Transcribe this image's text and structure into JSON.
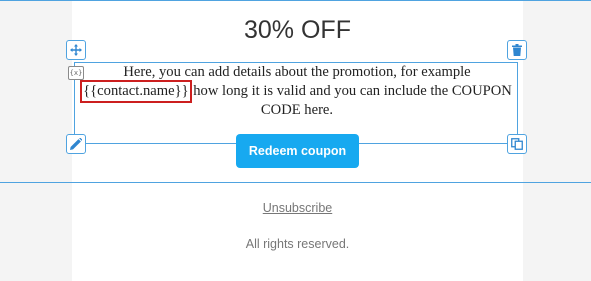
{
  "headline": "30% OFF",
  "body": {
    "before_tag": "Here, you can add details about the promotion, for example",
    "merge_tag": "{{contact.name}}",
    "after_tag": "how long it is valid and you can include the COUPON CODE here."
  },
  "variable_icon_label": "{x}",
  "cta": {
    "label": "Redeem coupon"
  },
  "footer": {
    "unsubscribe": "Unsubscribe",
    "rights": "All rights reserved."
  },
  "toolbar": {
    "move_icon": "move-icon",
    "delete_icon": "trash-icon",
    "edit_icon": "pencil-icon",
    "duplicate_icon": "copy-icon"
  },
  "colors": {
    "selection_border": "#4fa3e0",
    "button_bg": "#17a9f0",
    "highlight": "#cc1f1f"
  }
}
